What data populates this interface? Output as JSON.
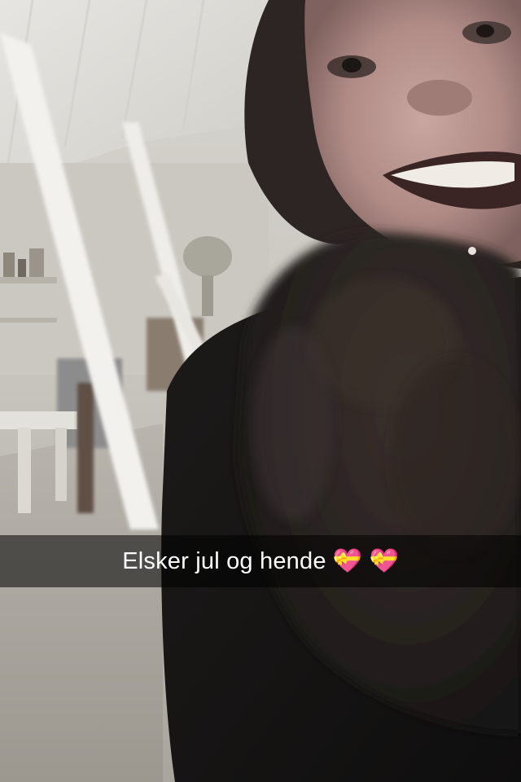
{
  "snap": {
    "caption": "Elsker jul og hende 💝 💝"
  },
  "icons": {
    "caption_emoji": "heart-with-ribbon-icon"
  }
}
